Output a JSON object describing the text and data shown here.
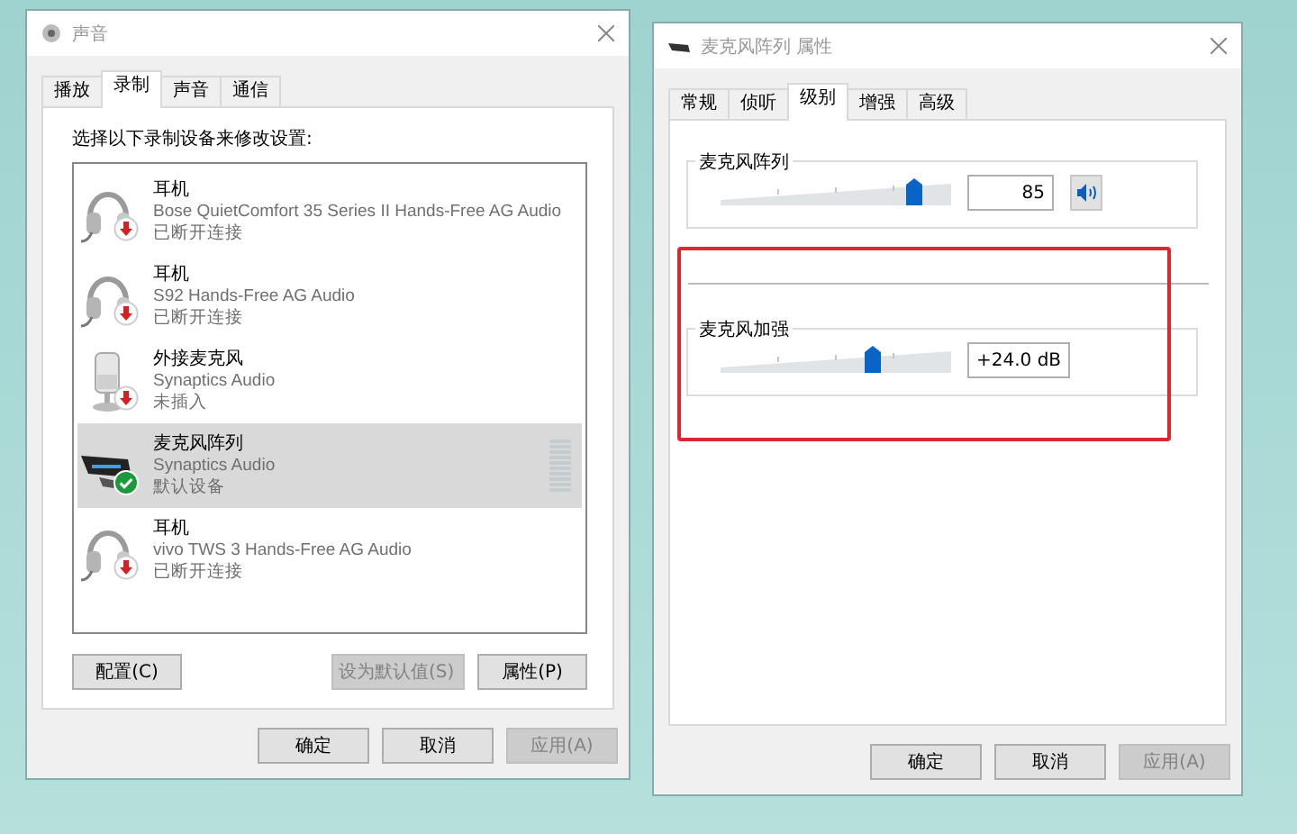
{
  "sound_window": {
    "title": "声音",
    "tabs": [
      {
        "label": "播放",
        "selected": false
      },
      {
        "label": "录制",
        "selected": true
      },
      {
        "label": "声音",
        "selected": false
      },
      {
        "label": "通信",
        "selected": false
      }
    ],
    "instruction": "选择以下录制设备来修改设置:",
    "devices": [
      {
        "kind": "headphones",
        "name": "耳机",
        "description": "Bose QuietComfort 35 Series II Hands-Free AG Audio",
        "status": "已断开连接",
        "default": false,
        "selected": false
      },
      {
        "kind": "headphones",
        "name": "耳机",
        "description": "S92 Hands-Free AG Audio",
        "status": "已断开连接",
        "default": false,
        "selected": false
      },
      {
        "kind": "microphone",
        "name": "外接麦克风",
        "description": "Synaptics Audio",
        "status": "未插入",
        "default": false,
        "selected": false
      },
      {
        "kind": "mic-array",
        "name": "麦克风阵列",
        "description": "Synaptics Audio",
        "status": "默认设备",
        "default": true,
        "selected": true
      },
      {
        "kind": "headphones",
        "name": "耳机",
        "description": "vivo TWS 3 Hands-Free AG Audio",
        "status": "已断开连接",
        "default": false,
        "selected": false
      }
    ],
    "buttons": [
      {
        "kind": "plain",
        "label": "配置(C)",
        "disabled": false
      },
      {
        "kind": "split",
        "label": "设为默认值(S)",
        "disabled": true
      },
      {
        "kind": "plain",
        "label": "属性(P)",
        "disabled": false
      }
    ],
    "dialog_buttons": [
      {
        "label": "确定",
        "disabled": false
      },
      {
        "label": "取消",
        "disabled": false
      },
      {
        "label": "应用(A)",
        "disabled": true
      }
    ]
  },
  "properties_window": {
    "title": "麦克风阵列 属性",
    "tabs": [
      {
        "label": "常规",
        "selected": false
      },
      {
        "label": "侦听",
        "selected": false
      },
      {
        "label": "级别",
        "selected": true
      },
      {
        "label": "增强",
        "selected": false
      },
      {
        "label": "高级",
        "selected": false
      }
    ],
    "levels": [
      {
        "kind": "volume",
        "label": "麦克风阵列",
        "level": 0.84,
        "value": "85"
      },
      {
        "kind": "boost",
        "label": "麦克风加强",
        "level": 0.66,
        "value": "+24.0 dB"
      }
    ],
    "highlight": {
      "color": "#e0262c"
    },
    "dialog_buttons": [
      {
        "label": "确定",
        "disabled": false
      },
      {
        "label": "取消",
        "disabled": false
      },
      {
        "label": "应用(A)",
        "disabled": true
      }
    ]
  }
}
